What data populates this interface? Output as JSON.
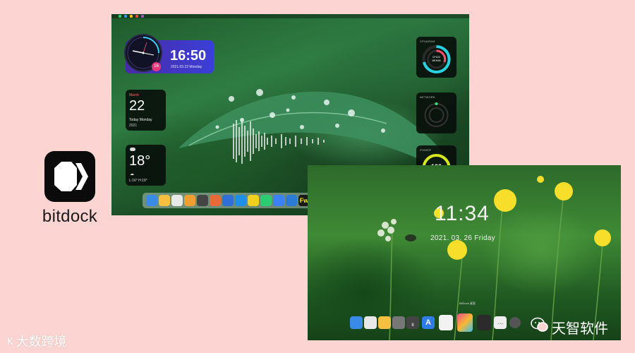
{
  "app": {
    "name": "bitdock",
    "logo_icon": "bitdock-logo-icon"
  },
  "screenshot_desktop": {
    "clock_widget": {
      "time": "16:50",
      "date": "2021.03.22 Monday",
      "badge": "16"
    },
    "calendar_widget": {
      "month": "March",
      "day": "22",
      "weekday": "Today Monday",
      "year": "2021"
    },
    "weather_widget": {
      "temperature": "18°",
      "condition": "☁",
      "range": "L:16° H:19°"
    },
    "cpu_widget": {
      "title": "CPU&RAM",
      "center": "CPU22\nMEM36"
    },
    "network_widget": {
      "title": "NETWORK"
    },
    "power_widget": {
      "title": "POWER",
      "value": "100",
      "label": "battery"
    },
    "dock_calendar_day": "22",
    "dock_fw_label": "Fw"
  },
  "screenshot_lockscreen": {
    "time": "11:34",
    "date": "2021. 03. 26  Friday",
    "dock_hint": "BitDock 桌面",
    "dock_count": "8"
  },
  "watermarks": {
    "left": "大数跨境",
    "left_logo": "K",
    "right": "天智软件"
  },
  "colors": {
    "background": "#fcd5d2",
    "clock_widget": "#4a2aa8",
    "power_ring": "#d7e81c",
    "cpu_ring": "#2ad1e0"
  }
}
